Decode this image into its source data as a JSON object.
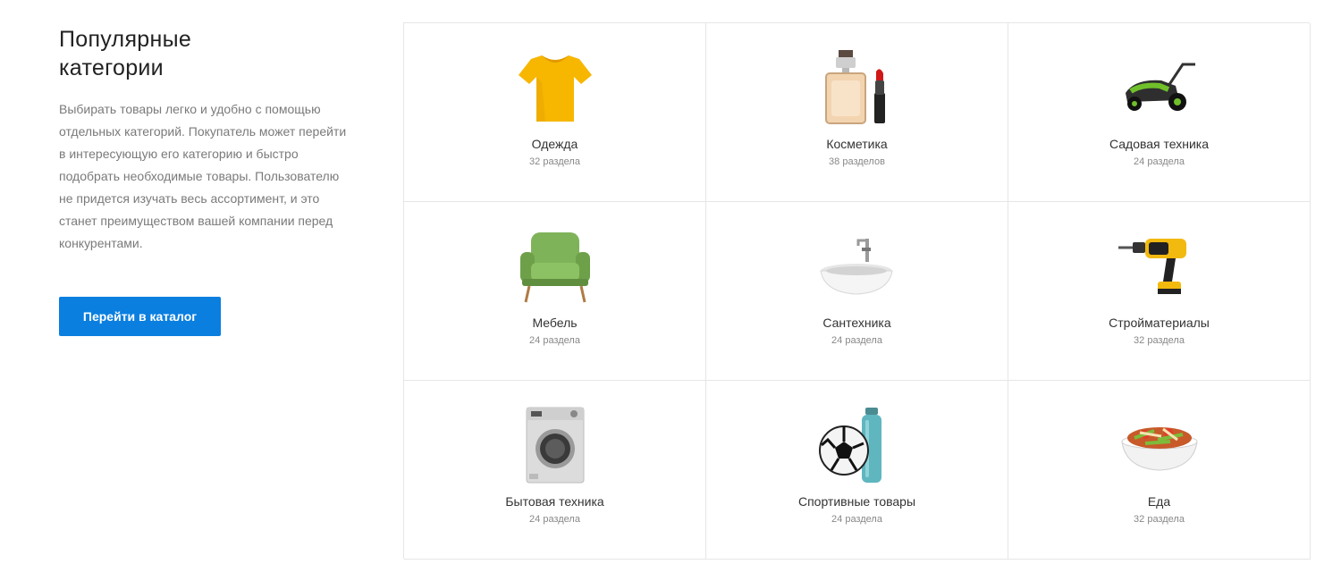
{
  "intro": {
    "title": "Популярные категории",
    "description": "Выбирать товары легко и удобно с помощью отдельных категорий. Покупатель может перейти в интересующую его категорию и быстро подобрать необходимые товары. Пользователю не придется изучать весь ассортимент, и это станет преимуществом вашей компании перед конкурентами.",
    "button_label": "Перейти в каталог",
    "accent_color": "#0a7fe0"
  },
  "categories": [
    {
      "name": "Одежда",
      "count": "32 раздела",
      "icon": "tshirt-icon"
    },
    {
      "name": "Косметика",
      "count": "38 разделов",
      "icon": "perfume-lipstick-icon"
    },
    {
      "name": "Садовая техника",
      "count": "24 раздела",
      "icon": "lawn-mower-icon"
    },
    {
      "name": "Мебель",
      "count": "24 раздела",
      "icon": "armchair-icon"
    },
    {
      "name": "Сантехника",
      "count": "24 раздела",
      "icon": "sink-icon"
    },
    {
      "name": "Стройматериалы",
      "count": "32 раздела",
      "icon": "drill-icon"
    },
    {
      "name": "Бытовая техника",
      "count": "24 раздела",
      "icon": "washing-machine-icon"
    },
    {
      "name": "Спортивные товары",
      "count": "24 раздела",
      "icon": "ball-bottle-icon"
    },
    {
      "name": "Еда",
      "count": "32 раздела",
      "icon": "salad-bowl-icon"
    }
  ]
}
